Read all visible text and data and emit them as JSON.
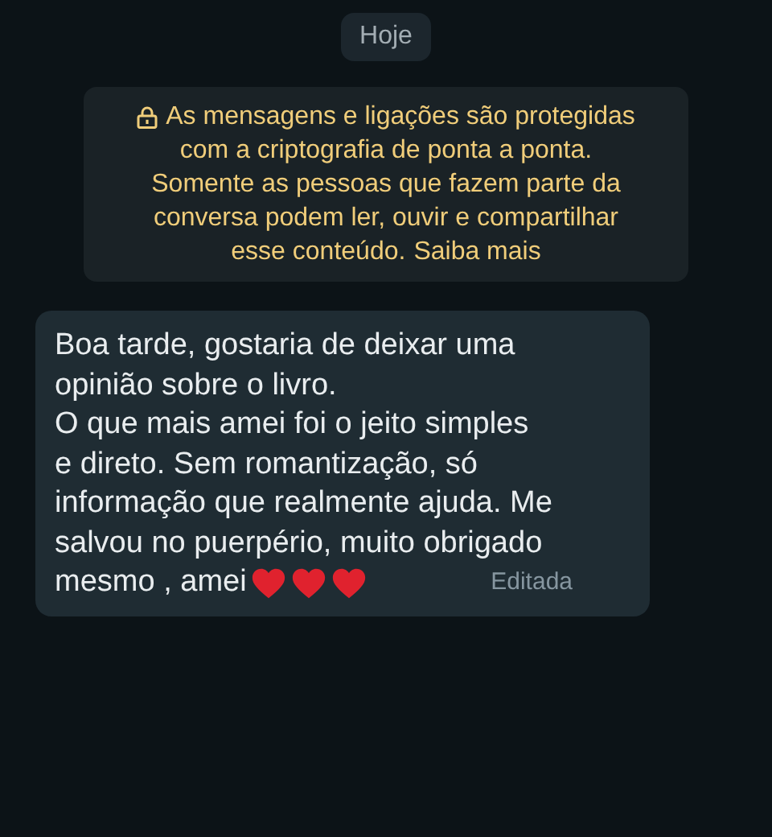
{
  "date_chip": "Hoje",
  "encryption_notice": {
    "lines": [
      "As mensagens e ligações são protegidas",
      "com a criptografia de ponta a ponta.",
      "Somente as pessoas que fazem parte da",
      "conversa podem ler, ouvir e compartilhar",
      "esse conteúdo."
    ],
    "link": "Saiba mais"
  },
  "messages": [
    {
      "lines": [
        "Boa tarde, gostaria de deixar uma",
        "opinião sobre o livro.",
        "O que mais amei foi o jeito simples",
        "e direto. Sem romantização, só",
        "informação que realmente ajuda. Me",
        "salvou no puerpério, muito obrigado",
        "mesmo , amei"
      ],
      "status": "Editada"
    }
  ]
}
